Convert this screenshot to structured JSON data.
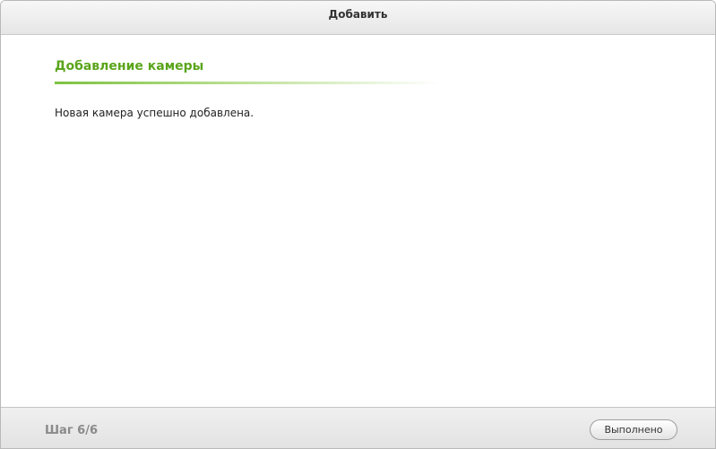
{
  "dialog": {
    "title": "Добавить"
  },
  "content": {
    "section_title": "Добавление камеры",
    "message": "Новая камера успешно добавлена."
  },
  "footer": {
    "step": "Шаг 6/6",
    "done_label": "Выполнено"
  },
  "colors": {
    "accent": "#5aa51b"
  }
}
